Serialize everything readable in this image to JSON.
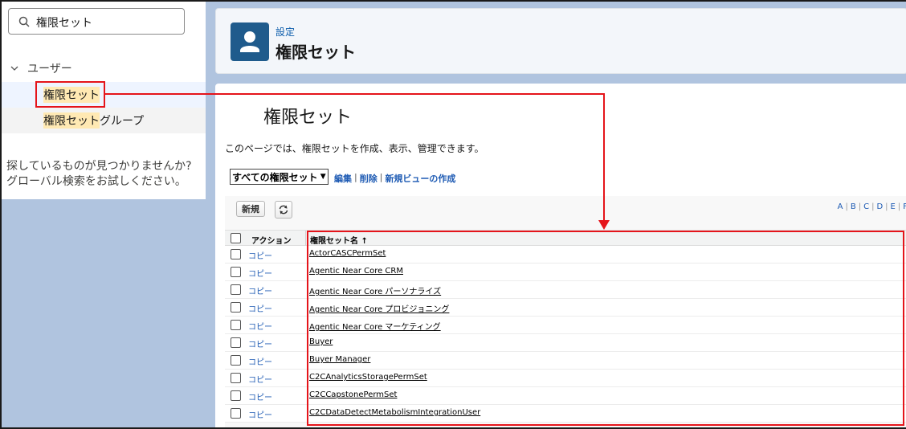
{
  "sidebar": {
    "search_value": "権限セット",
    "tree_parent": "ユーザー",
    "items": [
      {
        "label": "権限セット",
        "highlight": "権限セット",
        "rest": ""
      },
      {
        "label": "権限セットグループ",
        "highlight": "権限セット",
        "rest": "グループ"
      }
    ],
    "not_found_line1": "探しているものが見つかりませんか?",
    "not_found_line2": "グローバル検索をお試しください。"
  },
  "header": {
    "breadcrumb": "設定",
    "title": "権限セット"
  },
  "content": {
    "title": "権限セット",
    "description": "このページでは、権限セットを作成、表示、管理できます。",
    "view_select": "すべての権限セット",
    "view_links": [
      "編集",
      "削除",
      "新規ビューの作成"
    ],
    "new_button": "新規",
    "alpha_index": [
      "A",
      "B",
      "C",
      "D",
      "E",
      "F"
    ],
    "columns": {
      "action": "アクション",
      "name": "権限セット名 ↑"
    },
    "rows": [
      {
        "action": "コピー",
        "name": "ActorCASCPermSet"
      },
      {
        "action": "コピー",
        "name": "Agentic Near Core CRM"
      },
      {
        "action": "コピー",
        "name": "Agentic Near Core パーソナライズ"
      },
      {
        "action": "コピー",
        "name": "Agentic Near Core プロビジョニング"
      },
      {
        "action": "コピー",
        "name": "Agentic Near Core マーケティング"
      },
      {
        "action": "コピー",
        "name": "Buyer"
      },
      {
        "action": "コピー",
        "name": "Buyer Manager"
      },
      {
        "action": "コピー",
        "name": "C2CAnalyticsStoragePermSet"
      },
      {
        "action": "コピー",
        "name": "C2CCapstonePermSet"
      },
      {
        "action": "コピー",
        "name": "C2CDataDetectMetabolismIntegrationUser"
      }
    ]
  },
  "colors": {
    "accent_red": "#e5141a",
    "link_blue": "#1d5ab3",
    "header_icon": "#1f5b8c",
    "highlight": "#ffe9b3"
  }
}
